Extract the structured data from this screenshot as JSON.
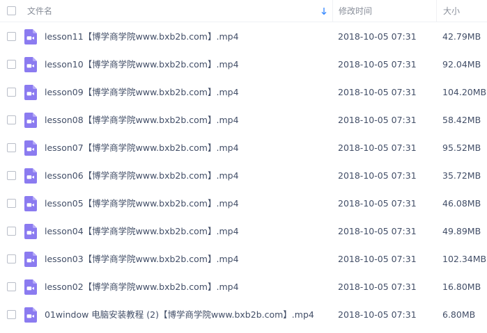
{
  "header": {
    "name_label": "文件名",
    "modified_label": "修改时间",
    "size_label": "大小"
  },
  "colors": {
    "accent": "#8b7bf0",
    "sort_arrow": "#3b8cff",
    "text": "#424e67",
    "header_text": "#888e99"
  },
  "files": [
    {
      "name": "lesson11【博学商学院www.bxb2b.com】.mp4",
      "modified": "2018-10-05 07:31",
      "size": "42.79MB",
      "icon": "video-file-icon"
    },
    {
      "name": "lesson10【博学商学院www.bxb2b.com】.mp4",
      "modified": "2018-10-05 07:31",
      "size": "92.04MB",
      "icon": "video-file-icon"
    },
    {
      "name": "lesson09【博学商学院www.bxb2b.com】.mp4",
      "modified": "2018-10-05 07:31",
      "size": "104.20MB",
      "icon": "video-file-icon"
    },
    {
      "name": "lesson08【博学商学院www.bxb2b.com】.mp4",
      "modified": "2018-10-05 07:31",
      "size": "58.42MB",
      "icon": "video-file-icon"
    },
    {
      "name": "lesson07【博学商学院www.bxb2b.com】.mp4",
      "modified": "2018-10-05 07:31",
      "size": "95.52MB",
      "icon": "video-file-icon"
    },
    {
      "name": "lesson06【博学商学院www.bxb2b.com】.mp4",
      "modified": "2018-10-05 07:31",
      "size": "35.72MB",
      "icon": "video-file-icon"
    },
    {
      "name": "lesson05【博学商学院www.bxb2b.com】.mp4",
      "modified": "2018-10-05 07:31",
      "size": "46.08MB",
      "icon": "video-file-icon"
    },
    {
      "name": "lesson04【博学商学院www.bxb2b.com】.mp4",
      "modified": "2018-10-05 07:31",
      "size": "49.89MB",
      "icon": "video-file-icon"
    },
    {
      "name": "lesson03【博学商学院www.bxb2b.com】.mp4",
      "modified": "2018-10-05 07:31",
      "size": "102.34MB",
      "icon": "video-file-icon"
    },
    {
      "name": "lesson02【博学商学院www.bxb2b.com】.mp4",
      "modified": "2018-10-05 07:31",
      "size": "16.80MB",
      "icon": "video-file-icon"
    },
    {
      "name": "01window 电脑安装教程 (2)【博学商学院www.bxb2b.com】.mp4",
      "modified": "2018-10-05 07:31",
      "size": "6.80MB",
      "icon": "video-file-icon"
    }
  ]
}
